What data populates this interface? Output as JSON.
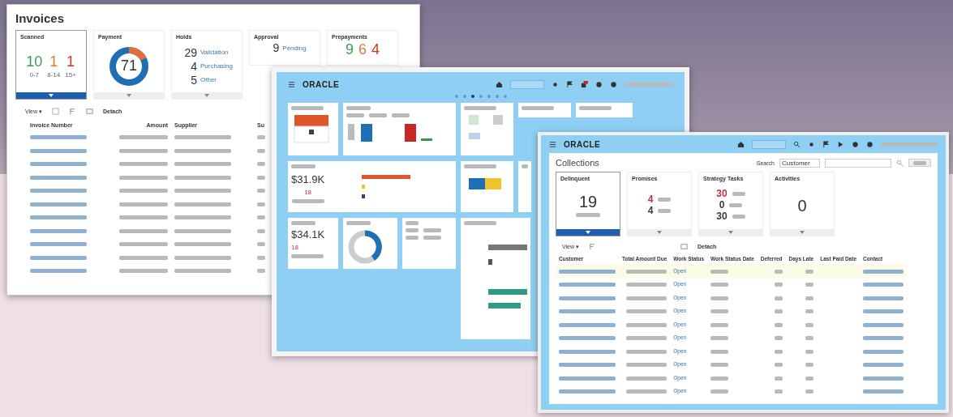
{
  "invoices_window": {
    "title": "Invoices",
    "tiles": [
      {
        "kind": "aging",
        "title": "Scanned",
        "selected": true,
        "items": [
          {
            "value": "10",
            "label": "0-7",
            "color": "#3c9a55"
          },
          {
            "value": "1",
            "label": "8-14",
            "color": "#e07b39"
          },
          {
            "value": "1",
            "label": "15+",
            "color": "#c0392b"
          }
        ]
      },
      {
        "kind": "donut",
        "title": "Payment",
        "selected": false,
        "value": "71"
      },
      {
        "kind": "list",
        "title": "Holds",
        "selected": false,
        "items": [
          {
            "value": "29",
            "label": "Validation"
          },
          {
            "value": "4",
            "label": "Purchasing"
          },
          {
            "value": "5",
            "label": "Other"
          }
        ]
      },
      {
        "kind": "list",
        "title": "Approval",
        "selected": false,
        "items": [
          {
            "value": "9",
            "label": "Pending"
          }
        ]
      },
      {
        "kind": "aging",
        "title": "Prepayments",
        "selected": false,
        "items": [
          {
            "value": "9",
            "color": "#3c9a55"
          },
          {
            "value": "6",
            "color": "#e07b39"
          },
          {
            "value": "4",
            "color": "#c0392b"
          }
        ]
      }
    ],
    "toolbar": {
      "view": "View ▾",
      "detach": "Detach"
    },
    "columns": [
      "Invoice Number",
      "Amount",
      "Supplier",
      "Su"
    ],
    "rows": [
      {
        "kind": "blurred"
      },
      {
        "kind": "blurred"
      },
      {
        "kind": "blurred"
      },
      {
        "kind": "blurred"
      },
      {
        "kind": "blurred"
      },
      {
        "kind": "blurred"
      },
      {
        "kind": "blurred"
      },
      {
        "kind": "blurred"
      },
      {
        "kind": "blurred"
      },
      {
        "kind": "blurred"
      },
      {
        "kind": "blurred"
      }
    ]
  },
  "dashboard_window": {
    "logo": "ORACLE",
    "pages": [
      {
        "selected": false
      },
      {
        "selected": false
      },
      {
        "selected": true
      },
      {
        "selected": false
      },
      {
        "selected": false
      },
      {
        "selected": false
      },
      {
        "selected": false
      }
    ],
    "tiles": [
      {
        "kind": "calendar"
      },
      {
        "kind": "kpi_bars"
      },
      {
        "kind": "icons"
      },
      {
        "kind": "blank"
      },
      {
        "kind": "blank"
      },
      {
        "kind": "amount_bars",
        "amount": "$31.9K",
        "count": "18"
      },
      {
        "kind": "stacked"
      },
      {
        "kind": "blank"
      },
      {
        "kind": "amount",
        "amount": "$34.1K",
        "count": "18"
      },
      {
        "kind": "donut"
      },
      {
        "kind": "ratios"
      },
      {
        "kind": "revenue"
      }
    ]
  },
  "collections_window": {
    "logo": "ORACLE",
    "title": "Collections",
    "search_label": "Search",
    "search_value": "Customer",
    "tiles": [
      {
        "kind": "single",
        "title": "Delinquent",
        "selected": true,
        "value": "19"
      },
      {
        "kind": "stack",
        "title": "Promises",
        "selected": false,
        "items": [
          {
            "value": "4",
            "color": "#c0304a"
          },
          {
            "value": "4",
            "color": "#3a3a3a"
          }
        ]
      },
      {
        "kind": "stack",
        "title": "Strategy Tasks",
        "selected": false,
        "items": [
          {
            "value": "30",
            "color": "#c0304a"
          },
          {
            "value": "0",
            "color": "#3a3a3a"
          },
          {
            "value": "30",
            "color": "#3a3a3a"
          }
        ]
      },
      {
        "kind": "single",
        "title": "Activities",
        "selected": false,
        "value": "0"
      }
    ],
    "toolbar": {
      "view": "View ▾",
      "detach": "Detach"
    },
    "columns": [
      "Customer",
      "Total Amount Due",
      "Work Status",
      "Work Status Date",
      "Deferred",
      "Days Late",
      "Last Paid Date",
      "Contact"
    ],
    "rows": [
      {
        "status": "Open",
        "highlighted": true
      },
      {
        "status": "Open",
        "highlighted": false
      },
      {
        "status": "Open",
        "highlighted": false
      },
      {
        "status": "Open",
        "highlighted": false
      },
      {
        "status": "Open",
        "highlighted": false
      },
      {
        "status": "Open",
        "highlighted": false
      },
      {
        "status": "Open",
        "highlighted": false
      },
      {
        "status": "Open",
        "highlighted": false
      },
      {
        "status": "Open",
        "highlighted": false
      },
      {
        "status": "Open",
        "highlighted": false
      }
    ]
  }
}
